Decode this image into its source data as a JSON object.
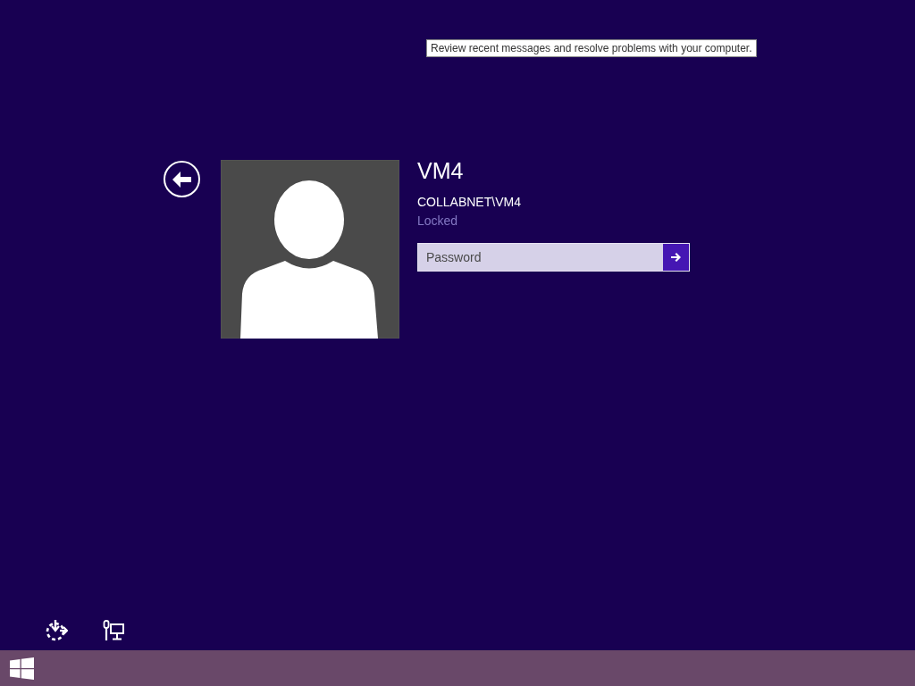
{
  "tooltip": {
    "text": "Review recent messages and resolve problems with your computer."
  },
  "user": {
    "name": "VM4",
    "account": "COLLABNET\\VM4",
    "status": "Locked"
  },
  "password": {
    "placeholder": "Password"
  }
}
